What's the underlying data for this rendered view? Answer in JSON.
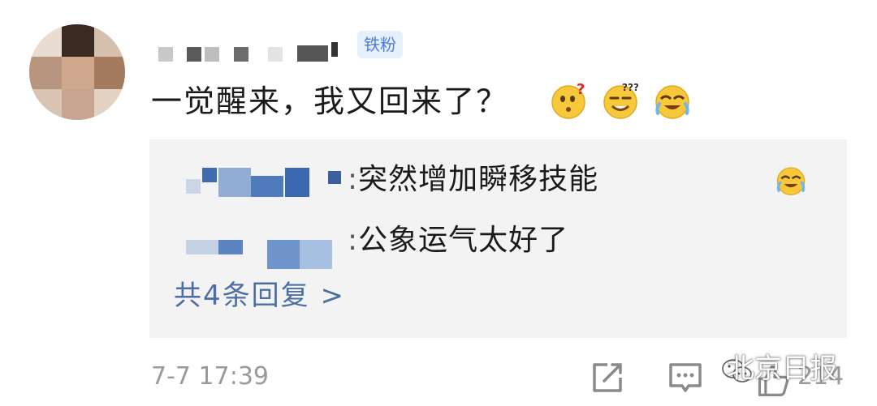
{
  "comment": {
    "badge": "铁粉",
    "text": "一觉醒来，我又回来了？",
    "emojis": [
      "thinking-question-emoji",
      "dizzy-smile-emoji",
      "laugh-cry-emoji"
    ]
  },
  "replies": {
    "items": [
      {
        "colon": ":",
        "text": "突然增加瞬移技能",
        "emoji": "laugh-cry-emoji"
      },
      {
        "colon": ":",
        "text": "公象运气太好了"
      }
    ],
    "more_label": "共4条回复 >"
  },
  "footer": {
    "time": "7-7 17:39",
    "likes": "214",
    "watermark": "北京日报"
  },
  "colors": {
    "badge_bg": "#e6effc",
    "badge_text": "#4a7fd6",
    "link": "#4b6fa5",
    "reply_bg": "#f3f3f3",
    "muted": "#9a9a9a"
  }
}
